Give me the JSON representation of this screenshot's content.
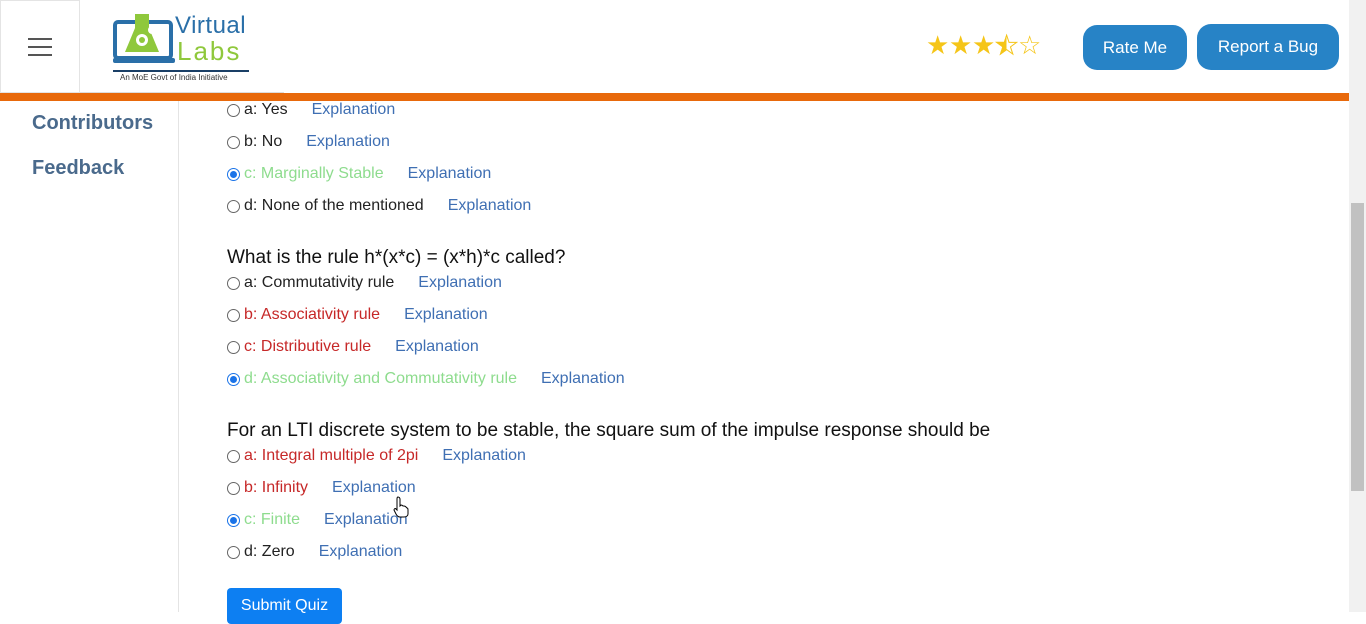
{
  "header": {
    "logo_top": "Virtual",
    "logo_bottom": "Labs",
    "logo_tagline": "An MoE Govt of India Initiative",
    "rating": 3.5,
    "rate_label": "Rate Me",
    "bug_label": "Report a Bug",
    "accent_color": "#2783c6",
    "bar_color": "#e8690b"
  },
  "sidebar": {
    "items": [
      {
        "label": "Contributors"
      },
      {
        "label": "Feedback"
      }
    ]
  },
  "quiz": {
    "q1_options": [
      {
        "prefix": "a: ",
        "text": "Yes",
        "state": "normal",
        "checked": false,
        "explain": "Explanation"
      },
      {
        "prefix": "b: ",
        "text": "No",
        "state": "normal",
        "checked": false,
        "explain": "Explanation"
      },
      {
        "prefix": "c: ",
        "text": "Marginally Stable",
        "state": "right",
        "checked": true,
        "explain": "Explanation"
      },
      {
        "prefix": "d: ",
        "text": "None of the mentioned",
        "state": "normal",
        "checked": false,
        "explain": "Explanation"
      }
    ],
    "q2": "What is the rule h*(x*c) = (x*h)*c called?",
    "q2_options": [
      {
        "prefix": "a: ",
        "text": "Commutativity rule",
        "state": "normal",
        "checked": false,
        "explain": "Explanation"
      },
      {
        "prefix": "b: ",
        "text": "Associativity rule",
        "state": "wrong",
        "checked": false,
        "explain": "Explanation"
      },
      {
        "prefix": "c: ",
        "text": "Distributive rule",
        "state": "wrong",
        "checked": false,
        "explain": "Explanation"
      },
      {
        "prefix": "d: ",
        "text": "Associativity and Commutativity rule",
        "state": "right",
        "checked": true,
        "explain": "Explanation"
      }
    ],
    "q3": "For an LTI discrete system to be stable, the square sum of the impulse response should be",
    "q3_options": [
      {
        "prefix": "a: ",
        "text": "Integral multiple of 2pi",
        "state": "wrong",
        "checked": false,
        "explain": "Explanation"
      },
      {
        "prefix": "b: ",
        "text": "Infinity",
        "state": "wrong",
        "checked": false,
        "explain": "Explanation"
      },
      {
        "prefix": "c: ",
        "text": "Finite",
        "state": "right",
        "checked": true,
        "explain": "Explanation"
      },
      {
        "prefix": "d: ",
        "text": "Zero",
        "state": "normal",
        "checked": false,
        "explain": "Explanation"
      }
    ],
    "submit_label": "Submit Quiz"
  }
}
